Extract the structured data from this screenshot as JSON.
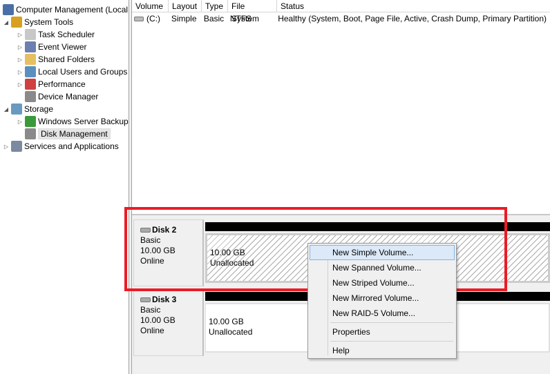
{
  "tree": [
    {
      "label": "Computer Management (Local",
      "level": 0,
      "expander": "",
      "icon": "computer-icon",
      "color": "#4a6fa5"
    },
    {
      "label": "System Tools",
      "level": 1,
      "expander": "◢",
      "icon": "tools-icon",
      "color": "#d8a020"
    },
    {
      "label": "Task Scheduler",
      "level": 2,
      "expander": "▷",
      "icon": "clock-icon",
      "color": "#c8c8c8"
    },
    {
      "label": "Event Viewer",
      "level": 2,
      "expander": "▷",
      "icon": "event-viewer-icon",
      "color": "#6b7fb0"
    },
    {
      "label": "Shared Folders",
      "level": 2,
      "expander": "▷",
      "icon": "shared-folder-icon",
      "color": "#e6c060"
    },
    {
      "label": "Local Users and Groups",
      "level": 2,
      "expander": "▷",
      "icon": "users-icon",
      "color": "#5a8fc0"
    },
    {
      "label": "Performance",
      "level": 2,
      "expander": "▷",
      "icon": "performance-icon",
      "color": "#d04040"
    },
    {
      "label": "Device Manager",
      "level": 2,
      "expander": "",
      "icon": "device-manager-icon",
      "color": "#8a8a8a"
    },
    {
      "label": "Storage",
      "level": 1,
      "expander": "◢",
      "icon": "storage-icon",
      "color": "#6a9ac0"
    },
    {
      "label": "Windows Server Backup",
      "level": 2,
      "expander": "▷",
      "icon": "backup-icon",
      "color": "#3a9a3a"
    },
    {
      "label": "Disk Management",
      "level": 2,
      "expander": "",
      "icon": "disk-management-icon",
      "color": "#8a8a8a",
      "selected": true
    },
    {
      "label": "Services and Applications",
      "level": 1,
      "expander": "▷",
      "icon": "services-icon",
      "color": "#7a8aa0",
      "root": true
    }
  ],
  "volume_list": {
    "columns": [
      "Volume",
      "Layout",
      "Type",
      "File System",
      "Status"
    ],
    "rows": [
      [
        "(C:)",
        "Simple",
        "Basic",
        "NTFS",
        "Healthy (System, Boot, Page File, Active, Crash Dump, Primary Partition)"
      ]
    ]
  },
  "disks": [
    {
      "name": "Disk 2",
      "type": "Basic",
      "size": "10.00 GB",
      "state": "Online",
      "partition_size": "10.00 GB",
      "partition_label": "Unallocated"
    },
    {
      "name": "Disk 3",
      "type": "Basic",
      "size": "10.00 GB",
      "state": "Online",
      "partition_size": "10.00 GB",
      "partition_label": "Unallocated"
    }
  ],
  "context_menu": {
    "items": [
      "New Simple Volume...",
      "New Spanned Volume...",
      "New Striped Volume...",
      "New Mirrored Volume...",
      "New RAID-5 Volume..."
    ],
    "properties": "Properties",
    "help": "Help"
  },
  "highlight_color": "#ea1c24"
}
